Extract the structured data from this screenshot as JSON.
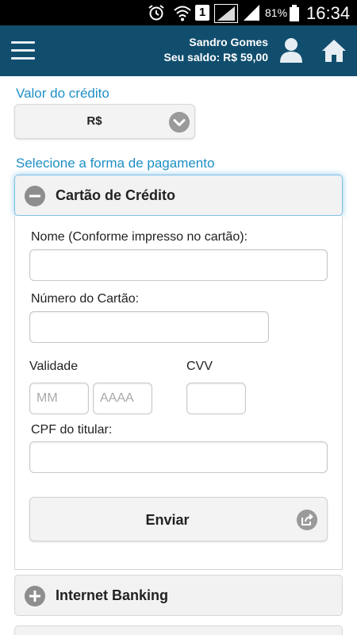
{
  "status_bar": {
    "battery_percent": "81%",
    "time": "16:34",
    "sim_slot": "1",
    "icons": [
      "alarm-icon",
      "wifi-icon",
      "sim-icon",
      "signal-icon",
      "signal-icon",
      "battery-icon"
    ]
  },
  "header": {
    "user_name": "Sandro Gomes",
    "balance": "Seu saldo: R$ 59,00",
    "icons": [
      "menu-icon",
      "user-icon",
      "home-icon"
    ]
  },
  "credit": {
    "label": "Valor do crédito",
    "selected_value": "R$"
  },
  "payment": {
    "label": "Selecione a forma de pagamento",
    "methods": [
      {
        "title": "Cartão de Crédito",
        "expanded": true
      },
      {
        "title": "Internet Banking",
        "expanded": false
      }
    ]
  },
  "card_form": {
    "name_label": "Nome (Conforme impresso no cartão):",
    "name_value": "",
    "number_label": "Número do Cartão:",
    "number_value": "",
    "validity_label": "Validade",
    "month_placeholder": "MM",
    "year_placeholder": "AAAA",
    "cvv_label": "CVV",
    "cvv_value": "",
    "cpf_label": "CPF do titular:",
    "cpf_value": "",
    "submit_label": "Enviar"
  },
  "colors": {
    "header_bg": "#114e6e",
    "accent_text": "#1d8fc5",
    "icon_gray": "#9a9a9a"
  }
}
